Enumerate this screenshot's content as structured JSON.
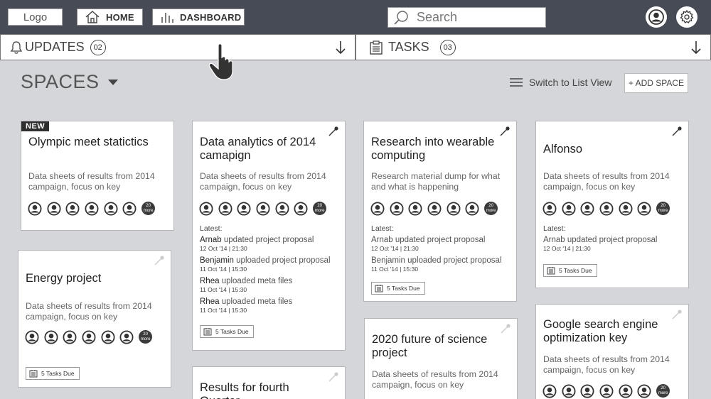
{
  "header": {
    "logo": "Logo",
    "nav": [
      {
        "label": "HOME",
        "icon": "home-icon"
      },
      {
        "label": "DASHBOARD",
        "icon": "dashboard-icon"
      }
    ],
    "search": {
      "placeholder": "Search",
      "value": ""
    },
    "icons": [
      "user-account-icon",
      "settings-gear-icon"
    ]
  },
  "strips": {
    "updates": {
      "label": "UPDATES",
      "count": "02"
    },
    "tasks": {
      "label": "TASKS",
      "count": "03"
    }
  },
  "spaces": {
    "title": "SPACES",
    "switch_view": "Switch to List View",
    "add_space": "+ ADD SPACE"
  },
  "avatars_more": "20 more",
  "latest_heading": "Latest:",
  "cards": [
    {
      "title": "Olympic meet statictics",
      "desc": "Data sheets of results from 2014 campaign, focus on key",
      "badge": "NEW"
    },
    {
      "title": "Energy project",
      "desc": "Data sheets of results from 2014 campaign, focus on key",
      "tasks_due": "5 Tasks Due"
    },
    {
      "title": "Data analytics of 2014 camapign",
      "desc": "Data sheets of results from 2014 campaign, focus on key",
      "activity": [
        {
          "who": "Arnab",
          "what": " updated project proposal",
          "when": "12 Oct '14 | 21:30"
        },
        {
          "who": "Benjamin",
          "what": " uploaded project proposal",
          "when": "11 Oct '14 | 15:30"
        },
        {
          "who": "Rhea",
          "what": " uploaded meta files",
          "when": "11 Oct '14 | 15:30"
        },
        {
          "who": "Rhea",
          "what": " uploaded meta files",
          "when": "11 Oct '14 | 15:30"
        }
      ],
      "tasks_due": "5 Tasks Due"
    },
    {
      "title": "Results for fourth Quarter",
      "desc": ""
    },
    {
      "title": "Research into wearable computing",
      "desc": "Research material dump for what and what is happening",
      "activity": [
        {
          "who": "Arnab",
          "what": " updated project proposal",
          "when": "12 Oct '14 | 21:30"
        },
        {
          "who": "Benjamin",
          "what": " uploaded project proposal",
          "when": "11 Oct '14 | 15:30"
        }
      ],
      "tasks_due": "5 Tasks Due"
    },
    {
      "title": "2020 future of  science project",
      "desc": "Data sheets of results from 2014 campaign, focus on key"
    },
    {
      "title": "Alfonso",
      "desc": "Data sheets of results from 2014 campaign, focus on key",
      "activity": [
        {
          "who": "Arnab",
          "what": " updated project proposal",
          "when": "12 Oct '14 | 21:30"
        }
      ],
      "tasks_due": "5 Tasks Due"
    },
    {
      "title": "Google search engine optimization key",
      "desc": "Data sheets of results from 2014 campaign, focus on key"
    }
  ]
}
